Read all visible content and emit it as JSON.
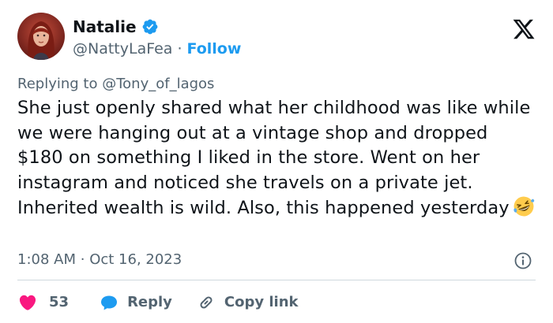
{
  "author": {
    "display_name": "Natalie",
    "handle": "@NattyLaFea",
    "separator": "·",
    "follow_label": "Follow"
  },
  "reply": {
    "prefix": "Replying to",
    "handle": "@Tony_of_lagos"
  },
  "tweet": {
    "text": "She just openly shared what her childhood was like while we were hanging out at a vintage shop and dropped $180 on something I liked in the store. Went on her instagram and noticed she travels on a private jet. Inherited wealth is wild. Also, this happened yesterday",
    "emoji": "rolling-on-floor-laughing"
  },
  "meta": {
    "time": "1:08 AM",
    "separator": "·",
    "date": "Oct 16, 2023"
  },
  "actions": {
    "likes": "53",
    "reply_label": "Reply",
    "copy_link_label": "Copy link"
  },
  "colors": {
    "accent": "#1d9bf0",
    "like": "#f91880",
    "muted": "#536471",
    "text": "#0f1419"
  },
  "icons": [
    "avatar",
    "verified-badge-icon",
    "x-logo-icon",
    "laughing-emoji-icon",
    "info-icon",
    "heart-icon",
    "reply-bubble-icon",
    "link-icon"
  ]
}
